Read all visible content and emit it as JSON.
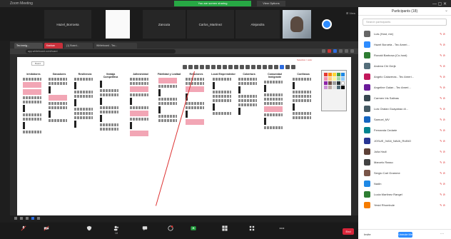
{
  "window": {
    "app_title": "Zoom Meeting",
    "share_banner": "You are screen sharing",
    "view_options": "View Options",
    "controls": "—  ▢  ✕"
  },
  "gallery": {
    "tiles": [
      {
        "name": "Hazel_Borroeta"
      },
      {
        "name": ""
      },
      {
        "name": "Zancuta"
      },
      {
        "name": "Carlos_Martinez"
      },
      {
        "name": "Alejandra"
      }
    ],
    "view_label": "⊞ View"
  },
  "browser": {
    "tabs": [
      "Tec inmig...",
      "Kanban",
      "(1) Board...",
      "Whiteboard - Tec..."
    ],
    "url": "app.whiteboard.com/board"
  },
  "board": {
    "doc_tab": "Board",
    "selection_label": "Selection / color",
    "columns": [
      {
        "title": "Inhibidores"
      },
      {
        "title": "Ganadores"
      },
      {
        "title": "Resiliencia"
      },
      {
        "title": "Ventaja Competitiva"
      },
      {
        "title": "Adhesividad"
      },
      {
        "title": "Fidelidad y Lealtad"
      },
      {
        "title": "Relaciones"
      },
      {
        "title": "Local Emprendedor"
      },
      {
        "title": "Cobertura"
      },
      {
        "title": "Comunidad Inmigrante"
      },
      {
        "title": "Confianza"
      }
    ]
  },
  "controls": {
    "items": [
      {
        "label": "Unmute",
        "icon": "mic-muted-icon"
      },
      {
        "label": "Start Video",
        "icon": "video-off-icon"
      },
      {
        "label": "Security",
        "icon": "shield-icon"
      },
      {
        "label": "Participants",
        "icon": "participants-icon",
        "count": "18"
      },
      {
        "label": "Chat",
        "icon": "chat-icon"
      },
      {
        "label": "Share Screen",
        "icon": "share-icon"
      },
      {
        "label": "Breakout Rooms",
        "icon": "breakout-icon"
      },
      {
        "label": "Reactions",
        "icon": "reactions-icon"
      },
      {
        "label": "More",
        "icon": "more-icon"
      }
    ],
    "end_label": "End"
  },
  "panel": {
    "title": "Participants (18)",
    "search_placeholder": "Search participants",
    "participants": [
      {
        "name": "Luis (Host, me)"
      },
      {
        "name": "Hazel Boroeta - Tec Ameri..."
      },
      {
        "name": "Ronald Barbosa (Co-host)"
      },
      {
        "name": "Andrea Chi Gerjk"
      },
      {
        "name": "Angelo Calaveras - Tec Ameri..."
      },
      {
        "name": "Angeline Galan - Tec Ameri..."
      },
      {
        "name": "Carmen Iris Salinas"
      },
      {
        "name": "Luis Oratan Guayabao di..."
      },
      {
        "name": "Samuel_MV"
      },
      {
        "name": "Fernanda Cedarie"
      },
      {
        "name": "JOSUE_IVAN_NAVA_RUBIO"
      },
      {
        "name": "Julia Hadi"
      },
      {
        "name": "Marcelo Rasso"
      },
      {
        "name": "Sergio Carl Gramme"
      },
      {
        "name": "Nadin"
      },
      {
        "name": "Lucia Martinez Rangel"
      },
      {
        "name": "Yesid Rhombule"
      }
    ],
    "invite_label": "Invite",
    "unmute_label": "Unmute Me",
    "more_label": "···"
  },
  "colors": {
    "zoom_blue": "#2d8cff",
    "share_green": "#27a844",
    "end_red": "#d9263a",
    "sticky_pink": "#f2a6b5"
  }
}
